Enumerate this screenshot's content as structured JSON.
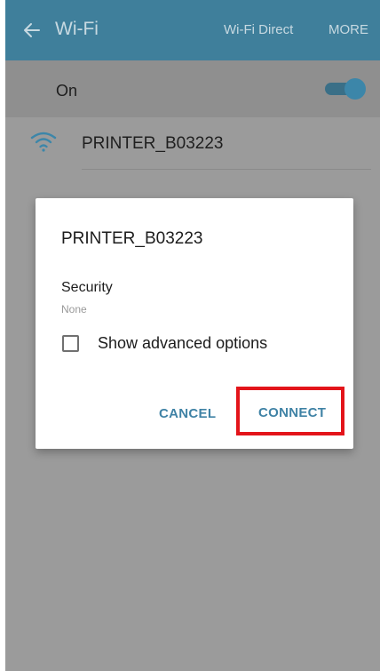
{
  "app_bar": {
    "title": "Wi-Fi",
    "wifi_direct_label": "Wi-Fi Direct",
    "more_label": "MORE",
    "color": "#3f7f9b"
  },
  "wifi_toggle": {
    "label": "On",
    "state": "on"
  },
  "network": {
    "name": "PRINTER_B03223",
    "icon": "wifi-signal-icon"
  },
  "dialog": {
    "title": "PRINTER_B03223",
    "security_label": "Security",
    "security_value": "None",
    "show_advanced_label": "Show advanced options",
    "show_advanced_checked": false,
    "cancel_label": "CANCEL",
    "connect_label": "CONNECT",
    "button_color": "#3f82a5",
    "highlight_color": "#e3141a"
  }
}
